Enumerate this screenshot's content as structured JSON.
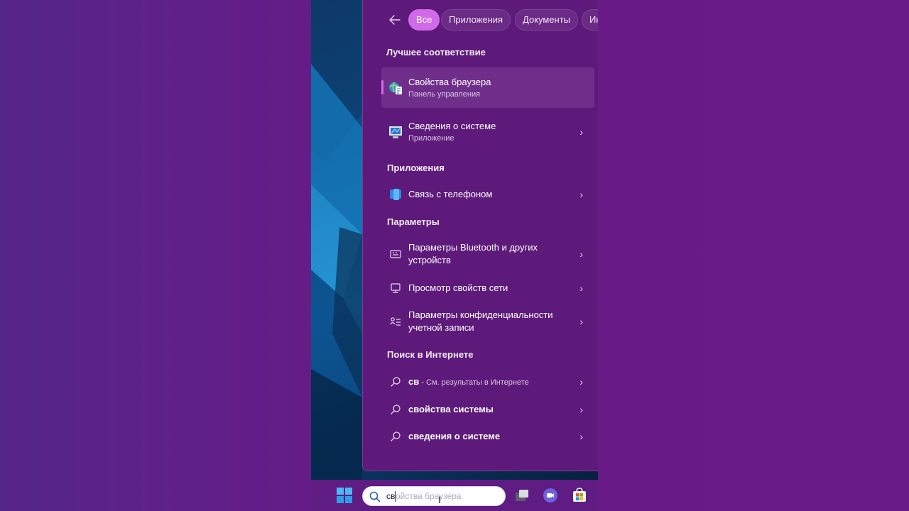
{
  "filters": {
    "back_label": "←",
    "chips": [
      "Все",
      "Приложения",
      "Документы",
      "Ин"
    ]
  },
  "sections": {
    "best_match": "Лучшее соответствие",
    "apps": "Приложения",
    "settings": "Параметры",
    "web": "Поиск в Интернете"
  },
  "best_match": {
    "title": "Свойства браузера",
    "subtitle": "Панель управления"
  },
  "system_info": {
    "title": "Сведения о системе",
    "subtitle": "Приложение"
  },
  "apps": [
    {
      "title": "Связь с телефоном"
    }
  ],
  "settings": [
    {
      "title": "Параметры Bluetooth и других устройств"
    },
    {
      "title": "Просмотр свойств сети"
    },
    {
      "title": "Параметры конфиденциальности учетной записи"
    }
  ],
  "web": [
    {
      "query": "св",
      "suffix": " - См. результаты в Интернете"
    },
    {
      "query": "свойства системы"
    },
    {
      "query": "сведения о системе"
    }
  ],
  "taskbar": {
    "search_typed": "св",
    "search_suggestion": "ойства браузера"
  },
  "colors": {
    "accent": "#d16ae9",
    "panel": "#5d1a7a",
    "background": "#5a1f7e"
  }
}
